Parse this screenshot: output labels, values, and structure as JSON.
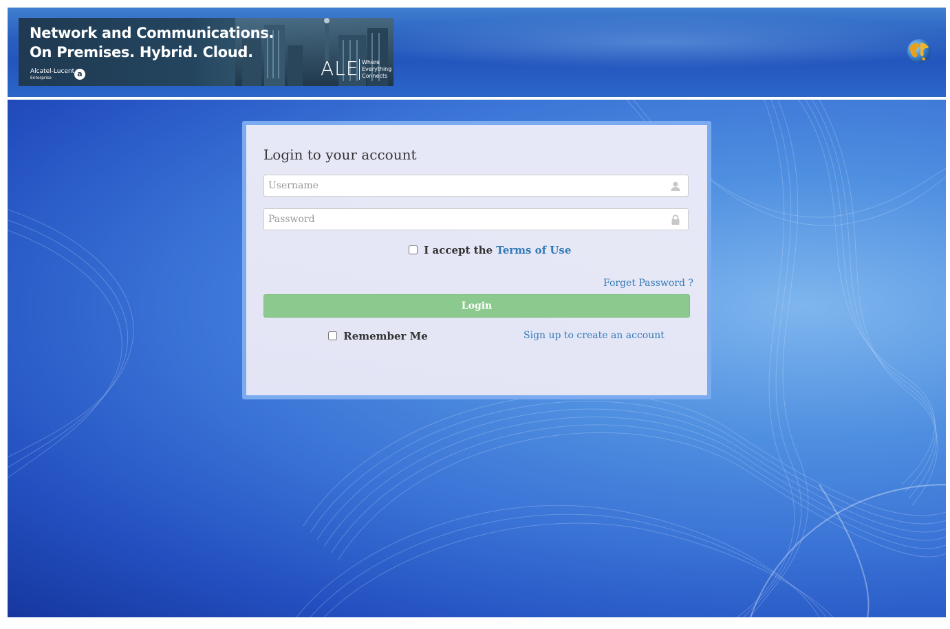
{
  "header": {
    "banner": {
      "headline_line1": "Network and Communications.",
      "headline_line2": "On Premises. Hybrid. Cloud.",
      "brand_name": "Alcatel-Lucent",
      "brand_sub": "Enterprise",
      "ale_logo": "ALE",
      "tagline": "Where Everything Connects"
    },
    "language_icon": "globe-icon"
  },
  "login": {
    "title": "Login to your account",
    "username_placeholder": "Username",
    "username_value": "",
    "password_placeholder": "Password",
    "password_value": "",
    "terms_prefix": "I accept the ",
    "terms_link": "Terms of Use",
    "terms_checked": false,
    "forget_password": "Forget Password ?",
    "login_button": "Login",
    "remember_me": "Remember Me",
    "remember_checked": false,
    "signup_link": "Sign up to create an account",
    "icons": {
      "username": "user-icon",
      "password": "lock-icon"
    }
  },
  "colors": {
    "header_blue": "#2456bd",
    "card_border": "#7aaaf0",
    "login_button": "#8cc98e",
    "link": "#337ab7"
  }
}
